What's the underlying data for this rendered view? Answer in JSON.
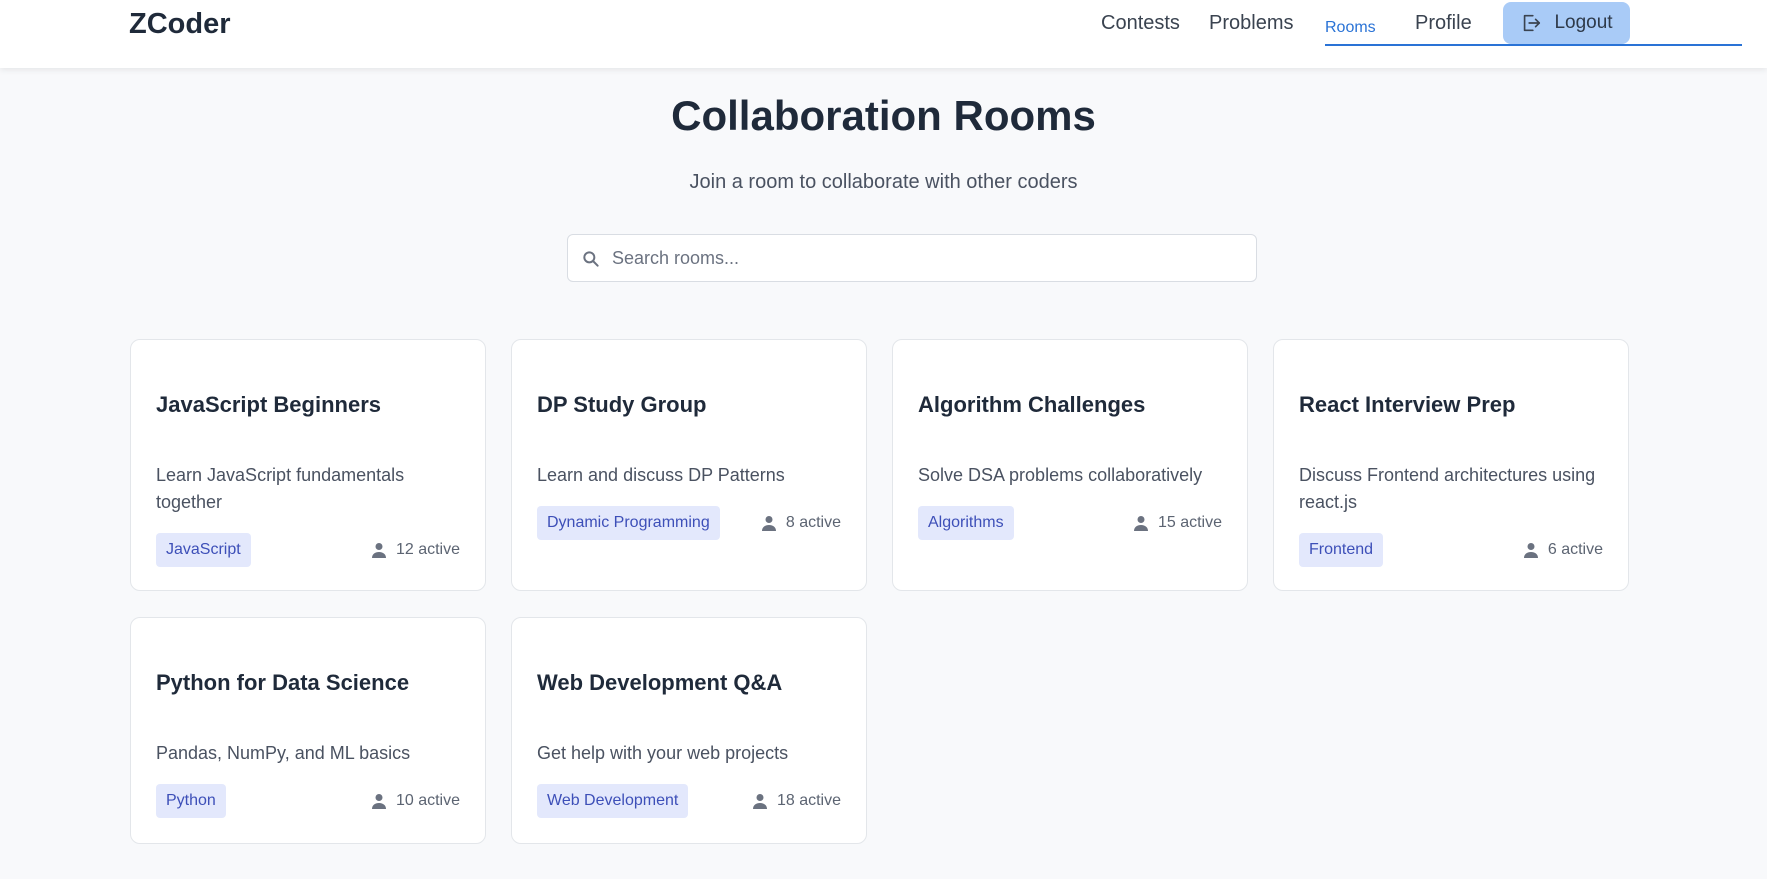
{
  "brand": "ZCoder",
  "nav": {
    "contests": "Contests",
    "problems": "Problems",
    "rooms": "Rooms",
    "profile": "Profile",
    "logout": "Logout"
  },
  "header": {
    "title": "Collaboration Rooms",
    "subtitle": "Join a room to collaborate with other coders"
  },
  "search": {
    "placeholder": "Search rooms...",
    "value": ""
  },
  "rooms": [
    {
      "name": "JavaScript Beginners",
      "description": "Learn JavaScript fundamentals together",
      "tag": "JavaScript",
      "active": "12 active"
    },
    {
      "name": "DP Study Group",
      "description": "Learn and discuss DP Patterns",
      "tag": "Dynamic Programming",
      "active": "8 active"
    },
    {
      "name": "Algorithm Challenges",
      "description": "Solve DSA problems collaboratively",
      "tag": "Algorithms",
      "active": "15 active"
    },
    {
      "name": "React Interview Prep",
      "description": "Discuss Frontend architectures using react.js",
      "tag": "Frontend",
      "active": "6 active"
    },
    {
      "name": "Python for Data Science",
      "description": "Pandas, NumPy, and ML basics",
      "tag": "Python",
      "active": "10 active"
    },
    {
      "name": "Web Development Q&A",
      "description": "Get help with your web projects",
      "tag": "Web Development",
      "active": "18 active"
    }
  ],
  "colors": {
    "accent": "#2a73d6",
    "logout_bg": "#a9cbf7",
    "tag_bg": "#e3e8fc",
    "tag_text": "#3d4fb8",
    "page_bg": "#f8f9fb"
  },
  "icons": {
    "logout": "logout-icon",
    "search": "search-icon",
    "user": "user-icon"
  }
}
